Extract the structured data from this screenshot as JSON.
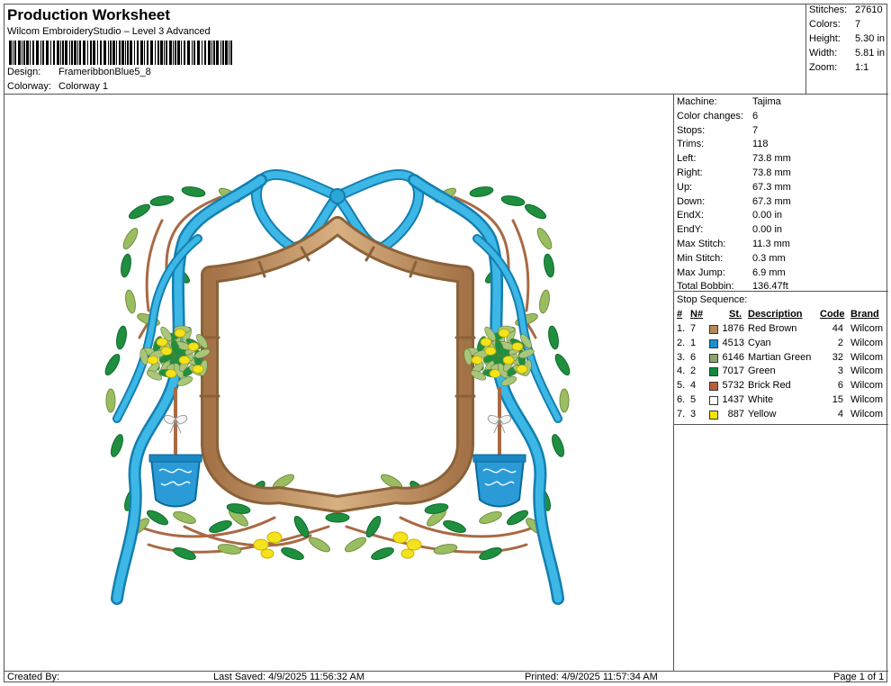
{
  "header": {
    "title": "Production Worksheet",
    "subtitle": "Wilcom EmbroideryStudio – Level 3 Advanced",
    "design_label": "Design:",
    "design_value": "FrameribbonBlue5_8",
    "colorway_label": "Colorway:",
    "colorway_value": "Colorway 1"
  },
  "summary": [
    {
      "k": "Stitches:",
      "v": "27610"
    },
    {
      "k": "Colors:",
      "v": "7"
    },
    {
      "k": "Height:",
      "v": "5.30 in"
    },
    {
      "k": "Width:",
      "v": "5.81 in"
    },
    {
      "k": "Zoom:",
      "v": "1:1"
    }
  ],
  "info": [
    {
      "k": "Machine:",
      "v": "Tajima"
    },
    {
      "k": "Color changes:",
      "v": "6"
    },
    {
      "k": "Stops:",
      "v": "7"
    },
    {
      "k": "Trims:",
      "v": "118"
    },
    {
      "k": "Left:",
      "v": "73.8 mm"
    },
    {
      "k": "Right:",
      "v": "73.8 mm"
    },
    {
      "k": "Up:",
      "v": "67.3 mm"
    },
    {
      "k": "Down:",
      "v": "67.3 mm"
    },
    {
      "k": "EndX:",
      "v": "0.00 in"
    },
    {
      "k": "EndY:",
      "v": "0.00 in"
    },
    {
      "k": "Max Stitch:",
      "v": "11.3 mm"
    },
    {
      "k": "Min Stitch:",
      "v": "0.3 mm"
    },
    {
      "k": "Max Jump:",
      "v": "6.9 mm"
    },
    {
      "k": "Total Bobbin:",
      "v": "136.47ft"
    }
  ],
  "stop_sequence": {
    "title": "Stop Sequence:",
    "headers": {
      "num": "#",
      "n": "N#",
      "st": "St.",
      "desc": "Description",
      "code": "Code",
      "brand": "Brand"
    },
    "rows": [
      {
        "num": "1.",
        "n": "7",
        "st": "1876",
        "desc": "Red Brown",
        "code": "44",
        "brand": "Wilcom",
        "color": "#b8875a"
      },
      {
        "num": "2.",
        "n": "1",
        "st": "4513",
        "desc": "Cyan",
        "code": "2",
        "brand": "Wilcom",
        "color": "#1a8fd0"
      },
      {
        "num": "3.",
        "n": "6",
        "st": "6146",
        "desc": "Martian Green",
        "code": "32",
        "brand": "Wilcom",
        "color": "#8aa76a"
      },
      {
        "num": "4.",
        "n": "2",
        "st": "7017",
        "desc": "Green",
        "code": "3",
        "brand": "Wilcom",
        "color": "#0f8a3c"
      },
      {
        "num": "5.",
        "n": "4",
        "st": "5732",
        "desc": "Brick Red",
        "code": "6",
        "brand": "Wilcom",
        "color": "#b85f3e"
      },
      {
        "num": "6.",
        "n": "5",
        "st": "1437",
        "desc": "White",
        "code": "15",
        "brand": "Wilcom",
        "color": "#ffffff"
      },
      {
        "num": "7.",
        "n": "3",
        "st": "887",
        "desc": "Yellow",
        "code": "4",
        "brand": "Wilcom",
        "color": "#f2e400"
      }
    ]
  },
  "footer": {
    "created": "Created By:",
    "saved": "Last Saved: 4/9/2025 11:56:32 AM",
    "printed": "Printed: 4/9/2025 11:57:34 AM",
    "page": "Page 1 of 1"
  },
  "colors": {
    "ribbon": "#2aa7d8",
    "ribbon_dark": "#137fb0",
    "frame": "#c49a6c",
    "frame_dark": "#8a6238",
    "leaf_dark": "#1f8f3f",
    "leaf_light": "#9bbd62",
    "lemon": "#f3e21c",
    "vine": "#a86a45",
    "pot": "#2a9bd6"
  }
}
